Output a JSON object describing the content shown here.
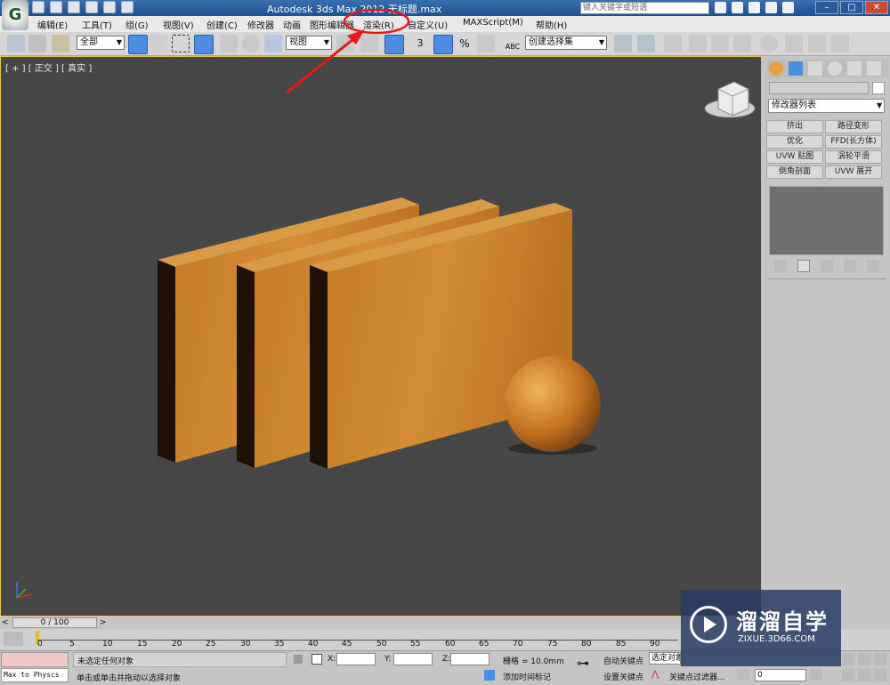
{
  "titlebar": {
    "title": "Autodesk 3ds Max  2012       无标题.max",
    "search_placeholder": "键入关键字或短语",
    "min": "–",
    "max": "□",
    "close": "✕"
  },
  "menu": {
    "items": [
      "编辑(E)",
      "工具(T)",
      "组(G)",
      "视图(V)",
      "创建(C)",
      "修改器",
      "动画",
      "图形编辑器",
      "渲染(R)",
      "自定义(U)",
      "MAXScript(M)",
      "帮助(H)"
    ]
  },
  "toolbar": {
    "filter_select": "全部",
    "coord_select": "视图",
    "snap_label": "3",
    "percent_label": "%",
    "named_selection": "创建选择集",
    "abc_label": "ABC"
  },
  "viewport": {
    "label": "[ + ] [ 正交 ] [ 真实 ]"
  },
  "cmdpanel": {
    "modifier_list": "修改器列表",
    "buttons": [
      "挤出",
      "路径变形",
      "优化",
      "FFD(长方体)",
      "UVW 贴图",
      "涡轮平滑",
      "倒角剖面",
      "UVW 展开"
    ]
  },
  "timeline": {
    "frame_display": "0 / 100",
    "prev": "<",
    "next": ">",
    "ticks": [
      "0",
      "5",
      "10",
      "15",
      "20",
      "25",
      "30",
      "35",
      "40",
      "45",
      "50",
      "55",
      "60",
      "65",
      "70",
      "75",
      "80",
      "85",
      "90"
    ]
  },
  "status": {
    "script_listener": "Max to Physcs",
    "selection_status": "未选定任何对象",
    "prompt": "单击或单击并拖动以选择对象",
    "x_label": "X:",
    "y_label": "Y:",
    "z_label": "Z:",
    "grid": "栅格 = 10.0mm",
    "add_time_tag": "添加时间标记",
    "auto_key": "自动关键点",
    "set_key": "设置关键点",
    "selected_object": "选定对象",
    "key_filters": "关键点过滤器...",
    "frame_field": "0"
  },
  "watermark": {
    "brand": "溜溜自学",
    "url": "ZIXUE.3D66.COM"
  }
}
